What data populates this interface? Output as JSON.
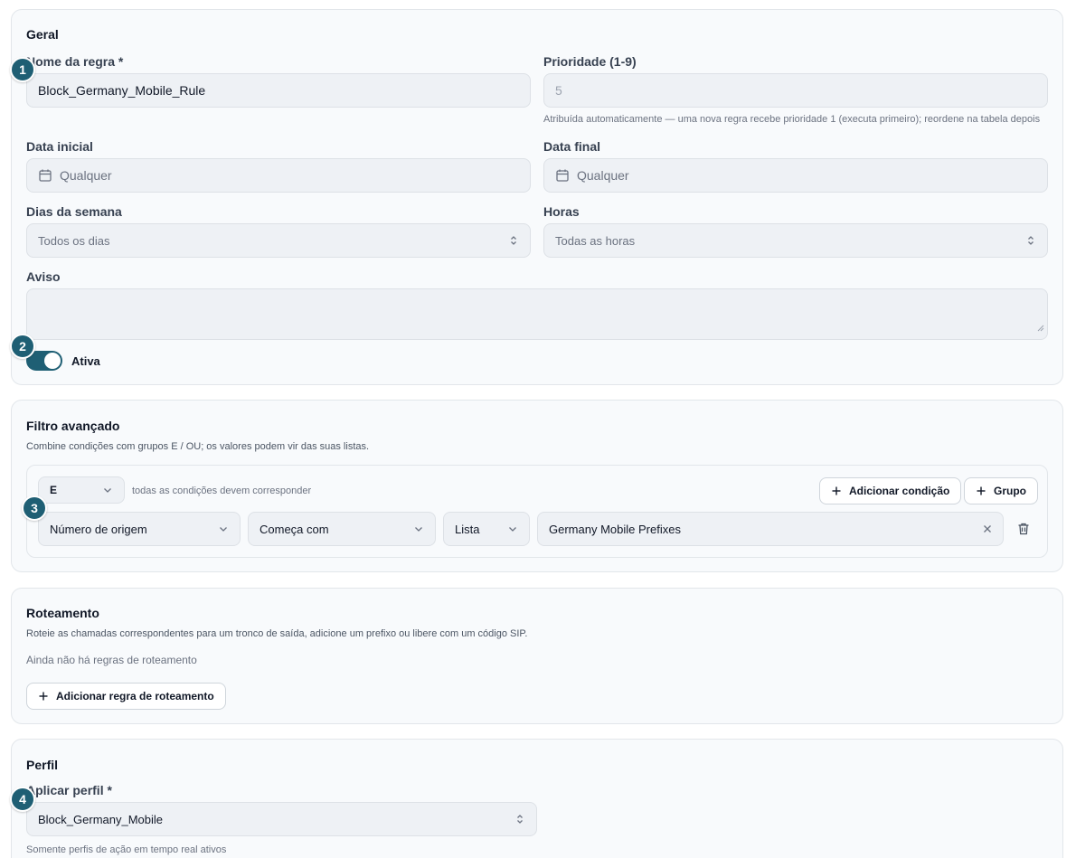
{
  "general": {
    "title": "Geral",
    "rule_name_label": "Nome da regra *",
    "rule_name_value": "Block_Germany_Mobile_Rule",
    "priority_label": "Prioridade (1-9)",
    "priority_value": "5",
    "priority_hint": "Atribuída automaticamente — uma nova regra recebe prioridade 1 (executa primeiro); reordene na tabela depois",
    "start_date_label": "Data inicial",
    "start_date_value": "Qualquer",
    "end_date_label": "Data final",
    "end_date_value": "Qualquer",
    "weekdays_label": "Dias da semana",
    "weekdays_value": "Todos os dias",
    "hours_label": "Horas",
    "hours_value": "Todas as horas",
    "notice_label": "Aviso",
    "active_label": "Ativa"
  },
  "filter": {
    "title": "Filtro avançado",
    "subtitle": "Combine condições com grupos E / OU; os valores podem vir das suas listas.",
    "group_op": "E",
    "group_hint": "todas as condições devem corresponder",
    "add_condition": "Adicionar condição",
    "add_group": "Grupo",
    "condition": {
      "field": "Número de origem",
      "operator": "Começa com",
      "source": "Lista",
      "value": "Germany Mobile Prefixes"
    }
  },
  "routing": {
    "title": "Roteamento",
    "subtitle": "Roteie as chamadas correspondentes para um tronco de saída, adicione um prefixo ou libere com um código SIP.",
    "empty": "Ainda não há regras de roteamento",
    "add_rule": "Adicionar regra de roteamento"
  },
  "profile": {
    "title": "Perfil",
    "apply_label": "Aplicar perfil *",
    "apply_value": "Block_Germany_Mobile",
    "hint": "Somente perfis de ação em tempo real ativos"
  },
  "badges": [
    "1",
    "2",
    "3",
    "4"
  ],
  "colors": {
    "accent": "#1f5f74",
    "card_bg": "#f8fafc",
    "field_bg": "#eef1f5"
  }
}
